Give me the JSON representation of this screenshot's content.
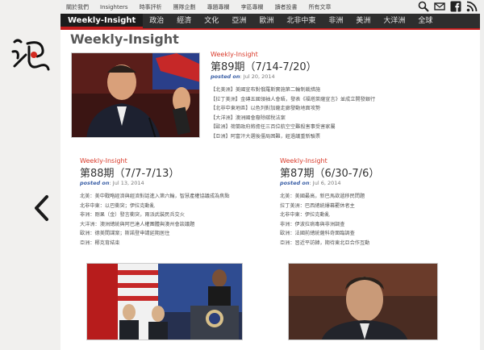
{
  "topnav": {
    "items": [
      "關於我們",
      "Insighters",
      "時事評析",
      "團隊企劃",
      "專題專欄",
      "李區專欄",
      "讀者投書",
      "所有文章"
    ]
  },
  "tools": [
    "search-icon",
    "email-icon",
    "facebook-icon",
    "rss-icon"
  ],
  "mainnav": {
    "items": [
      "Weekly-Insight",
      "政治",
      "經濟",
      "文化",
      "亞洲",
      "歐洲",
      "北非中東",
      "非洲",
      "美洲",
      "大洋洲",
      "全球"
    ],
    "active_index": 0
  },
  "page": {
    "title": "Weekly-Insight"
  },
  "featured": {
    "kicker": "Weekly-Insight",
    "issue": "第89期（7/14-7/20）",
    "posted_label": "posted on",
    "posted_date": "Jul 20, 2014",
    "items": [
      "【北美洲】美國宣布對俄羅斯實施第二輪制裁措施",
      "【拉丁美洲】金磚五國領袖人會晤，發表《福塔萊薩宣言》並成立開發銀行",
      "【北非中東地區】以色列對加薩走廊發動地面攻勢",
      "【大洋洲】澳洲國會廢除碳稅法案",
      "【歐洲】荷蘭政府將擔任三百位航空空難殺害事受害家屬",
      "【亞洲】阿富汗大選後僵局困難，經過議重新驗票"
    ]
  },
  "issue88": {
    "kicker": "Weekly-Insight",
    "issue": "第88期（7/7-7/13）",
    "posted_label": "posted on",
    "posted_date": "Jul 13, 2014",
    "items": [
      "北美：美中戰略經濟與經濟對話進入第六輪，智慧產權協議成為焦點",
      "北非中東：以巴衝突；伊拉克動亂",
      "非洲：剛果（金）發言衝突，兩派武裝民兵交火",
      "大洋洲：澳洲總統與阿巴達人權團體與澳州會談議題",
      "歐洲：德美間諜案；斯諾登申請延期居住",
      "亞洲：椰克育結束"
    ]
  },
  "issue87": {
    "kicker": "Weekly-Insight",
    "issue": "第87期（6/30-7/6）",
    "posted_label": "posted on",
    "posted_date": "Jul 6, 2014",
    "items": [
      "北美：美國最高，新巴馬欲遞移民問題",
      "拉丁美洲：巴西總統爆幕罷休者主",
      "北非中東：伊拉克動亂",
      "非洲：伊波拉病毒與非洲調查",
      "歐洲：法國前總統薩科奇面臨調查",
      "亞洲：習近平訪韓，期待東北亞合作互動"
    ]
  },
  "colors": {
    "nav_bg": "#2e2e2e",
    "accent": "#c21d1d",
    "kicker": "#d93a2a",
    "posted": "#3a5fa6"
  }
}
